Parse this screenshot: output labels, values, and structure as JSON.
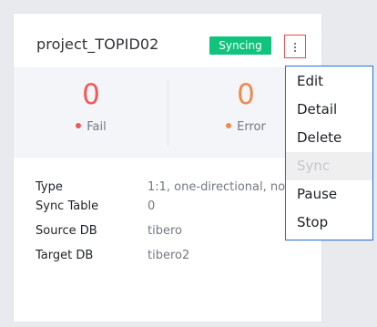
{
  "project": {
    "title": "project_TOPID02",
    "status": "Syncing",
    "menu_icon": "kebab-menu-icon"
  },
  "metrics": {
    "fail": {
      "value": "0",
      "label": "Fail"
    },
    "error": {
      "value": "0",
      "label": "Error"
    }
  },
  "details": [
    {
      "label": "Type",
      "value": "1:1, one-directional, no"
    },
    {
      "label": "Sync Table",
      "value": "0"
    },
    {
      "label": "Source DB",
      "value": "tibero"
    },
    {
      "label": "Target DB",
      "value": "tibero2"
    }
  ],
  "menu": {
    "items": [
      {
        "label": "Edit",
        "state": "enabled"
      },
      {
        "label": "Detail",
        "state": "enabled"
      },
      {
        "label": "Delete",
        "state": "enabled"
      },
      {
        "label": "Sync",
        "state": "disabled"
      },
      {
        "label": "Pause",
        "state": "enabled"
      },
      {
        "label": "Stop",
        "state": "enabled"
      }
    ]
  },
  "colors": {
    "background": "#e9eaee",
    "status_badge": "#12c37e",
    "fail": "#ef5a5a",
    "error": "#f08a4b",
    "menu_border": "#2a71d7"
  }
}
